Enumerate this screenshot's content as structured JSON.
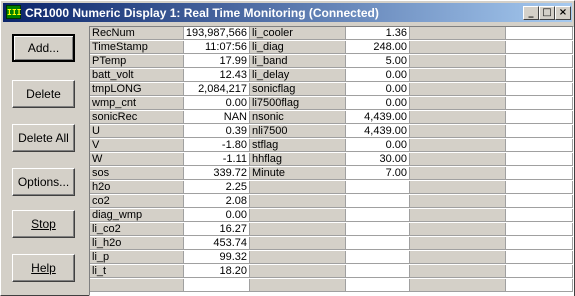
{
  "window": {
    "title": "CR1000 Numeric Display 1: Real Time Monitoring (Connected)",
    "icon_text": "III",
    "controls": {
      "minimize": "_",
      "maximize": "□",
      "close": "×"
    }
  },
  "buttons": {
    "add": "Add...",
    "delete": "Delete",
    "delete_all": "Delete All",
    "options": "Options...",
    "stop": "Stop",
    "help": "Help"
  },
  "table": {
    "column1": [
      {
        "label": "RecNum",
        "value": "193,987,566"
      },
      {
        "label": "TimeStamp",
        "value": "11:07:56"
      },
      {
        "label": "PTemp",
        "value": "17.99"
      },
      {
        "label": "batt_volt",
        "value": "12.43"
      },
      {
        "label": "tmpLONG",
        "value": "2,084,217"
      },
      {
        "label": "wmp_cnt",
        "value": "0.00"
      },
      {
        "label": "sonicRec",
        "value": "NAN"
      },
      {
        "label": "U",
        "value": "0.39"
      },
      {
        "label": "V",
        "value": "-1.80"
      },
      {
        "label": "W",
        "value": "-1.11"
      },
      {
        "label": "sos",
        "value": "339.72"
      },
      {
        "label": "h2o",
        "value": "2.25"
      },
      {
        "label": "co2",
        "value": "2.08"
      },
      {
        "label": "diag_wmp",
        "value": "0.00"
      },
      {
        "label": "li_co2",
        "value": "16.27"
      },
      {
        "label": "li_h2o",
        "value": "453.74"
      },
      {
        "label": "li_p",
        "value": "99.32"
      },
      {
        "label": "li_t",
        "value": "18.20"
      }
    ],
    "column2": [
      {
        "label": "li_cooler",
        "value": "1.36"
      },
      {
        "label": "li_diag",
        "value": "248.00"
      },
      {
        "label": "li_band",
        "value": "5.00"
      },
      {
        "label": "li_delay",
        "value": "0.00"
      },
      {
        "label": "sonicflag",
        "value": "0.00"
      },
      {
        "label": "li7500flag",
        "value": "0.00"
      },
      {
        "label": "nsonic",
        "value": "4,439.00"
      },
      {
        "label": "nli7500",
        "value": "4,439.00"
      },
      {
        "label": "stflag",
        "value": "0.00"
      },
      {
        "label": "hhflag",
        "value": "30.00"
      },
      {
        "label": "Minute",
        "value": "7.00"
      }
    ]
  }
}
